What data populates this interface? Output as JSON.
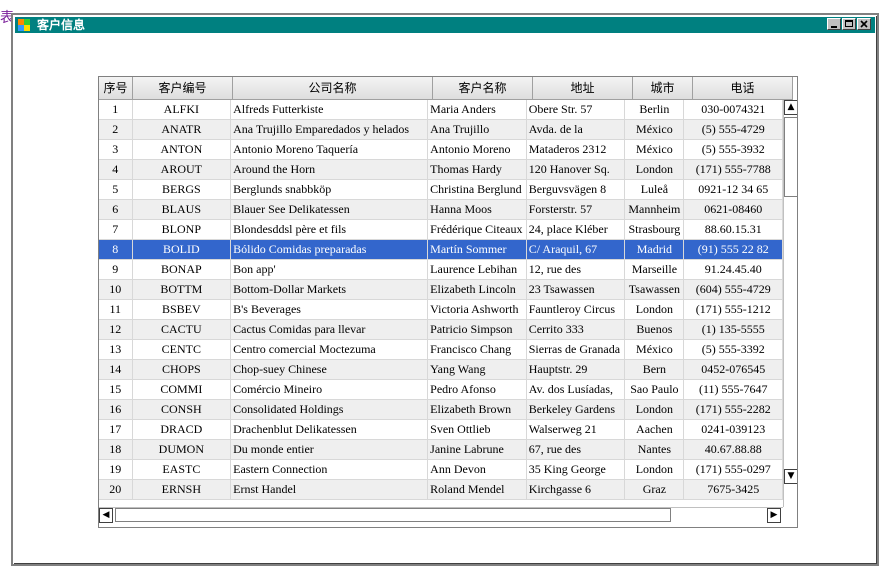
{
  "page": {
    "edge_text": "表"
  },
  "window": {
    "title": "客户信息",
    "buttons": [
      "minimize-button",
      "maximize-button",
      "close-button"
    ]
  },
  "grid": {
    "columns": [
      {
        "key": "num",
        "label": "序号",
        "width": 34,
        "center": true
      },
      {
        "key": "id",
        "label": "客户编号",
        "width": 100,
        "center": true
      },
      {
        "key": "company",
        "label": "公司名称",
        "width": 200,
        "center": false
      },
      {
        "key": "contact",
        "label": "客户名称",
        "width": 100,
        "center": false
      },
      {
        "key": "address",
        "label": "地址",
        "width": 100,
        "center": false
      },
      {
        "key": "city",
        "label": "城市",
        "width": 60,
        "center": true
      },
      {
        "key": "phone",
        "label": "电话",
        "width": 100,
        "center": true
      }
    ],
    "selected_row": 7,
    "rows": [
      {
        "num": "1",
        "id": "ALFKI",
        "company": "Alfreds Futterkiste",
        "contact": "Maria Anders",
        "address": "Obere Str. 57",
        "city": "Berlin",
        "phone": "030-0074321"
      },
      {
        "num": "2",
        "id": "ANATR",
        "company": "Ana Trujillo Emparedados y helados",
        "contact": "Ana Trujillo",
        "address": "Avda. de la",
        "city": "México",
        "phone": "(5) 555-4729"
      },
      {
        "num": "3",
        "id": "ANTON",
        "company": "Antonio Moreno Taquería",
        "contact": "Antonio Moreno",
        "address": "Mataderos 2312",
        "city": "México",
        "phone": "(5) 555-3932"
      },
      {
        "num": "4",
        "id": "AROUT",
        "company": "Around the Horn",
        "contact": "Thomas Hardy",
        "address": "120 Hanover Sq.",
        "city": "London",
        "phone": "(171) 555-7788"
      },
      {
        "num": "5",
        "id": "BERGS",
        "company": "Berglunds snabbköp",
        "contact": "Christina Berglund",
        "address": "Berguvsvägen 8",
        "city": "Luleå",
        "phone": "0921-12 34 65"
      },
      {
        "num": "6",
        "id": "BLAUS",
        "company": "Blauer See Delikatessen",
        "contact": "Hanna Moos",
        "address": "Forsterstr. 57",
        "city": "Mannheim",
        "phone": "0621-08460"
      },
      {
        "num": "7",
        "id": "BLONP",
        "company": "Blondesddsl père et fils",
        "contact": "Frédérique Citeaux",
        "address": "24, place Kléber",
        "city": "Strasbourg",
        "phone": "88.60.15.31"
      },
      {
        "num": "8",
        "id": "BOLID",
        "company": "Bólido Comidas preparadas",
        "contact": "Martín Sommer",
        "address": "C/ Araquil, 67",
        "city": "Madrid",
        "phone": "(91) 555 22 82"
      },
      {
        "num": "9",
        "id": "BONAP",
        "company": "Bon app'",
        "contact": "Laurence Lebihan",
        "address": "12, rue des",
        "city": "Marseille",
        "phone": "91.24.45.40"
      },
      {
        "num": "10",
        "id": "BOTTM",
        "company": "Bottom-Dollar Markets",
        "contact": "Elizabeth Lincoln",
        "address": "23 Tsawassen",
        "city": "Tsawassen",
        "phone": "(604) 555-4729"
      },
      {
        "num": "11",
        "id": "BSBEV",
        "company": "B's Beverages",
        "contact": "Victoria Ashworth",
        "address": "Fauntleroy Circus",
        "city": "London",
        "phone": "(171) 555-1212"
      },
      {
        "num": "12",
        "id": "CACTU",
        "company": "Cactus Comidas para llevar",
        "contact": "Patricio Simpson",
        "address": "Cerrito 333",
        "city": "Buenos",
        "phone": "(1) 135-5555"
      },
      {
        "num": "13",
        "id": "CENTC",
        "company": "Centro comercial Moctezuma",
        "contact": "Francisco Chang",
        "address": "Sierras de Granada",
        "city": "México",
        "phone": "(5) 555-3392"
      },
      {
        "num": "14",
        "id": "CHOPS",
        "company": "Chop-suey Chinese",
        "contact": "Yang Wang",
        "address": "Hauptstr. 29",
        "city": "Bern",
        "phone": "0452-076545"
      },
      {
        "num": "15",
        "id": "COMMI",
        "company": "Comércio Mineiro",
        "contact": "Pedro Afonso",
        "address": "Av. dos Lusíadas,",
        "city": "Sao Paulo",
        "phone": "(11) 555-7647"
      },
      {
        "num": "16",
        "id": "CONSH",
        "company": "Consolidated Holdings",
        "contact": "Elizabeth Brown",
        "address": "Berkeley Gardens",
        "city": "London",
        "phone": "(171) 555-2282"
      },
      {
        "num": "17",
        "id": "DRACD",
        "company": "Drachenblut Delikatessen",
        "contact": "Sven Ottlieb",
        "address": "Walserweg 21",
        "city": "Aachen",
        "phone": "0241-039123"
      },
      {
        "num": "18",
        "id": "DUMON",
        "company": "Du monde entier",
        "contact": "Janine Labrune",
        "address": "67, rue des",
        "city": "Nantes",
        "phone": "40.67.88.88"
      },
      {
        "num": "19",
        "id": "EASTC",
        "company": "Eastern Connection",
        "contact": "Ann Devon",
        "address": "35 King George",
        "city": "London",
        "phone": "(171) 555-0297"
      },
      {
        "num": "20",
        "id": "ERNSH",
        "company": "Ernst Handel",
        "contact": "Roland Mendel",
        "address": "Kirchgasse 6",
        "city": "Graz",
        "phone": "7675-3425"
      }
    ]
  },
  "scrollbars": {
    "up_arrow": "▲",
    "down_arrow": "▼",
    "left_arrow": "◀",
    "right_arrow": "▶"
  }
}
